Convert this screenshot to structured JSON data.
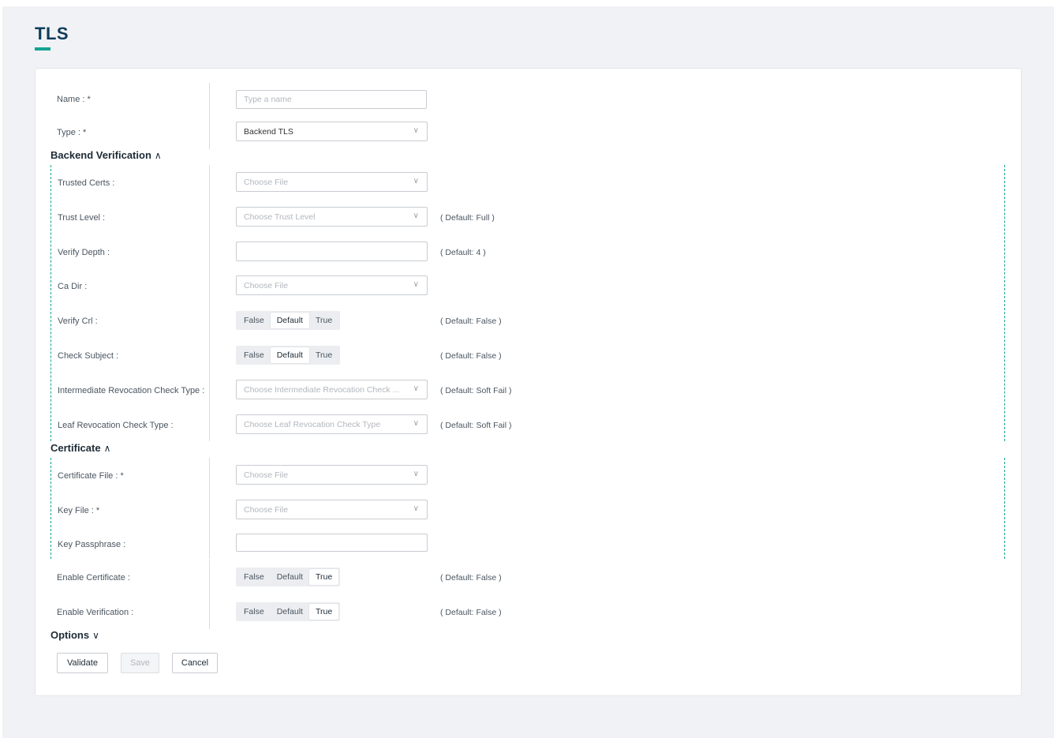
{
  "page": {
    "title": "TLS"
  },
  "general": {
    "name_label": "Name : *",
    "name_placeholder": "Type a name",
    "type_label": "Type : *",
    "type_value": "Backend TLS"
  },
  "backend_verification": {
    "title": "Backend Verification",
    "trusted_certs_label": "Trusted Certs :",
    "trusted_certs_placeholder": "Choose File",
    "trust_level_label": "Trust Level :",
    "trust_level_placeholder": "Choose Trust Level",
    "trust_level_default": "( Default: Full )",
    "verify_depth_label": "Verify Depth :",
    "verify_depth_value": "",
    "verify_depth_default": "( Default: 4 )",
    "ca_dir_label": "Ca Dir :",
    "ca_dir_placeholder": "Choose File",
    "verify_crl_label": "Verify Crl :",
    "verify_crl_default": "( Default: False )",
    "check_subject_label": "Check Subject :",
    "check_subject_default": "( Default: False )",
    "intermediate_label": "Intermediate Revocation Check Type :",
    "intermediate_placeholder": "Choose Intermediate Revocation Check ...",
    "intermediate_default": "( Default: Soft Fail )",
    "leaf_label": "Leaf Revocation Check Type :",
    "leaf_placeholder": "Choose Leaf Revocation Check Type",
    "leaf_default": "( Default: Soft Fail )"
  },
  "certificate": {
    "title": "Certificate",
    "cert_file_label": "Certificate File : *",
    "cert_file_placeholder": "Choose File",
    "key_file_label": "Key File : *",
    "key_file_placeholder": "Choose File",
    "key_passphrase_label": "Key Passphrase :",
    "key_passphrase_value": ""
  },
  "toggles": {
    "false_label": "False",
    "default_label": "Default",
    "true_label": "True",
    "enable_certificate_label": "Enable Certificate :",
    "enable_certificate_default": "( Default: False )",
    "enable_verification_label": "Enable Verification :",
    "enable_verification_default": "( Default: False )"
  },
  "options": {
    "title": "Options"
  },
  "buttons": {
    "validate": "Validate",
    "save": "Save",
    "cancel": "Cancel"
  },
  "colors": {
    "accent": "#14a393",
    "title": "#0e3c5b",
    "page_bg": "#f1f2f5"
  },
  "icons": {
    "expand_up": "chevron-up-icon",
    "expand_down": "chevron-down-icon",
    "select": "chevron-down-icon"
  }
}
